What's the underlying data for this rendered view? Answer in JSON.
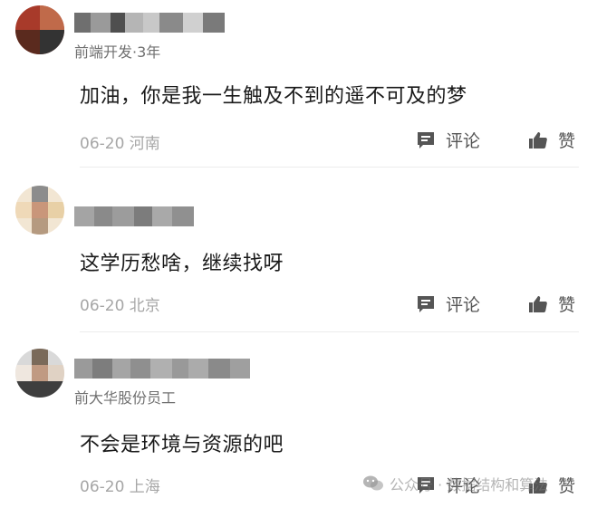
{
  "comments": [
    {
      "author_subtitle": "前端开发·3年",
      "text": "加油，你是我一生触及不到的遥不可及的梦",
      "date_location": "06-20 河南",
      "comment_label": "评论",
      "like_label": "赞"
    },
    {
      "author_subtitle": "",
      "text": "这学历愁啥，继续找呀",
      "date_location": "06-20 北京",
      "comment_label": "评论",
      "like_label": "赞"
    },
    {
      "author_subtitle": "前大华股份员工",
      "text": "不会是环境与资源的吧",
      "date_location": "06-20 上海",
      "comment_label": "评论",
      "like_label": "赞"
    }
  ],
  "watermark": {
    "text": "公众号 · 数据结构和算法"
  },
  "colors": {
    "text_primary": "#1a1a1a",
    "text_meta": "#707070",
    "text_date": "#a6a6a6",
    "icon_gray": "#555555"
  }
}
